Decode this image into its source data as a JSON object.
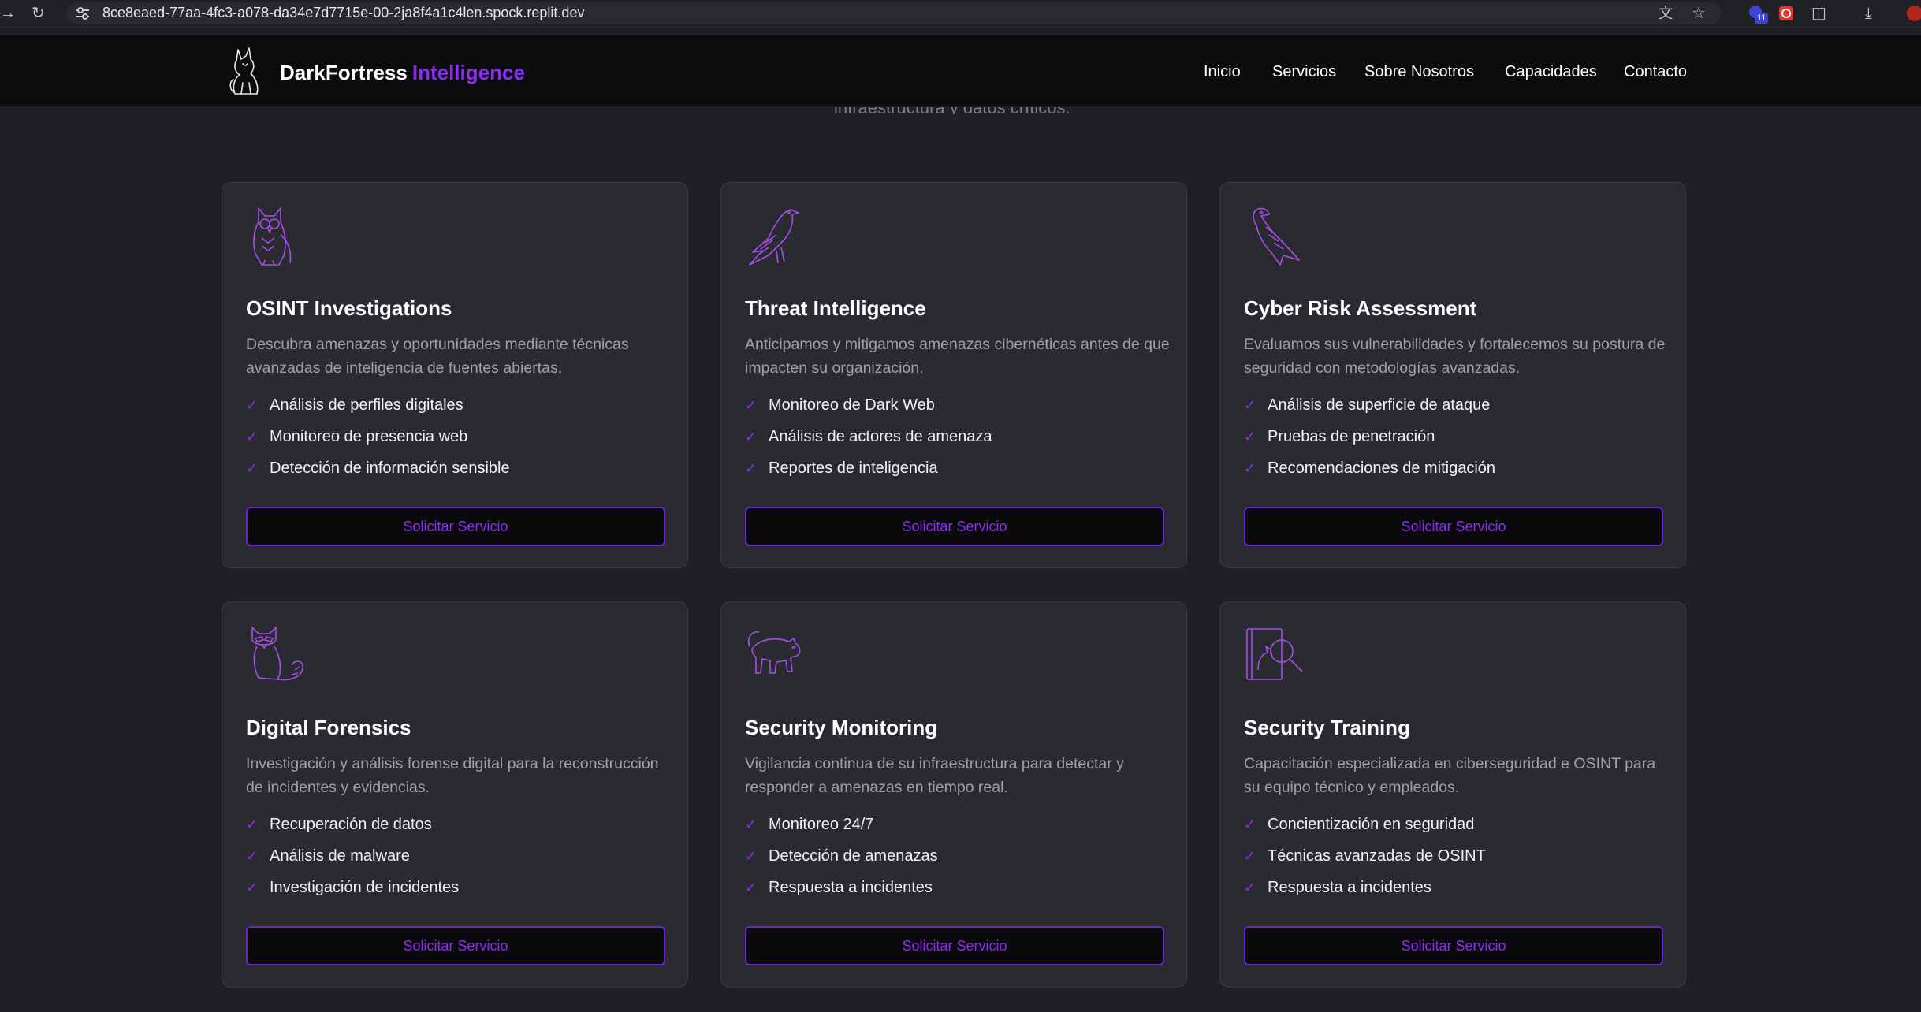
{
  "browser": {
    "url": "8ce8eaed-77aa-4fc3-a078-da34e7d7715e-00-2ja8f4a1c4len.spock.replit.dev",
    "extension_badge": "11"
  },
  "header": {
    "brand_main": "DarkFortress",
    "brand_accent": "Intelligence",
    "nav": [
      "Inicio",
      "Servicios",
      "Sobre Nosotros",
      "Capacidades",
      "Contacto"
    ]
  },
  "section": {
    "subtitle_tail": "infraestructura y datos críticos."
  },
  "colors": {
    "accent": "#8b2cf5",
    "background": "#1f1f24",
    "card": "#2a2a31",
    "header": "#0c0c0e"
  },
  "cards": [
    {
      "icon": "owl-icon",
      "title": "OSINT Investigations",
      "description": "Descubra amenazas y oportunidades mediante técnicas avanzadas de inteligencia de fuentes abiertas.",
      "features": [
        "Análisis de perfiles digitales",
        "Monitoreo de presencia web",
        "Detección de información sensible"
      ],
      "button": "Solicitar Servicio"
    },
    {
      "icon": "raven-icon",
      "title": "Threat Intelligence",
      "description": "Anticipamos y mitigamos amenazas cibernéticas antes de que impacten su organización.",
      "features": [
        "Monitoreo de Dark Web",
        "Análisis de actores de amenaza",
        "Reportes de inteligencia"
      ],
      "button": "Solicitar Servicio"
    },
    {
      "icon": "eagle-icon",
      "title": "Cyber Risk Assessment",
      "description": "Evaluamos sus vulnerabilidades y fortalecemos su postura de seguridad con metodologías avanzadas.",
      "features": [
        "Análisis de superficie de ataque",
        "Pruebas de penetración",
        "Recomendaciones de mitigación"
      ],
      "button": "Solicitar Servicio"
    },
    {
      "icon": "raccoon-icon",
      "title": "Digital Forensics",
      "description": "Investigación y análisis forense digital para la reconstrucción de incidentes y evidencias.",
      "features": [
        "Recuperación de datos",
        "Análisis de malware",
        "Investigación de incidentes"
      ],
      "button": "Solicitar Servicio"
    },
    {
      "icon": "panther-icon",
      "title": "Security Monitoring",
      "description": "Vigilancia continua de su infraestructura para detectar y responder a amenazas en tiempo real.",
      "features": [
        "Monitoreo 24/7",
        "Detección de amenazas",
        "Respuesta a incidentes"
      ],
      "button": "Solicitar Servicio"
    },
    {
      "icon": "book-magnifier-icon",
      "title": "Security Training",
      "description": "Capacitación especializada en ciberseguridad e OSINT para su equipo técnico y empleados.",
      "features": [
        "Concientización en seguridad",
        "Técnicas avanzadas de OSINT",
        "Respuesta a incidentes"
      ],
      "button": "Solicitar Servicio"
    }
  ]
}
